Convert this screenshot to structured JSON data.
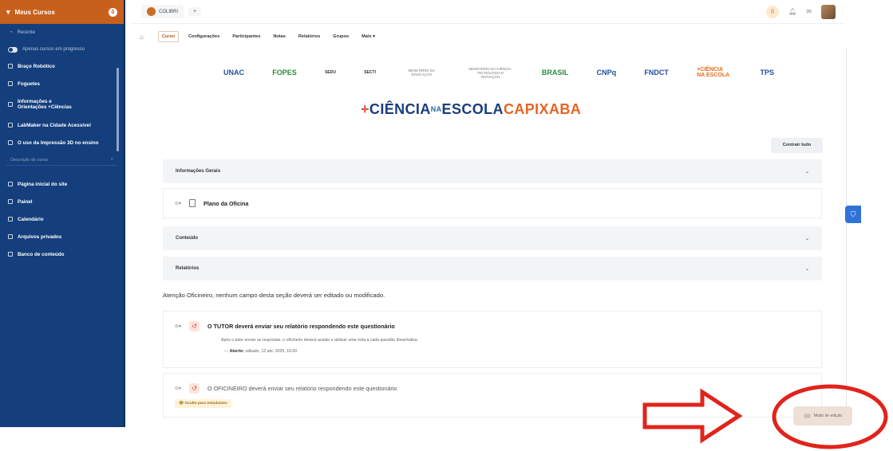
{
  "sidebar": {
    "header": "Meus Cursos",
    "header_badge": "0",
    "sub_item": "Recente",
    "toggle_label": "Apenas cursos em progresso",
    "courses": [
      "Braço Robótico",
      "Foguetes",
      "Informações e Orientações +Ciências",
      "LabMaker na Cidade Acessível",
      "O uso da Impressão 3D no ensino"
    ],
    "search_placeholder": "Descrição do curso",
    "nav": [
      "Página inicial do site",
      "Painel",
      "Calendário",
      "Arquivos privados",
      "Banco de conteúdo"
    ]
  },
  "topbar": {
    "brand": "COLIBRI",
    "plus": "+",
    "notif_count": "6"
  },
  "subnav": {
    "home_icon": "⌂",
    "tabs": [
      "Curso",
      "Configurações",
      "Participantes",
      "Notas",
      "Relatórios",
      "Grupos",
      "Mais ▾"
    ]
  },
  "banner": {
    "logos": [
      "UNAC",
      "FOPES",
      "SEDU",
      "SECTI",
      "MINISTÉRIO DA EDUCAÇÃO",
      "MINISTÉRIO DA CIÊNCIA, TECNOLOGIA E INOVAÇÃO",
      "BRASIL",
      "CNPq",
      "FNDCT",
      "+CIÊNCIA NA ESCOLA",
      "TPS"
    ],
    "title_plus": "+",
    "title_a": "CIÊNCIA",
    "title_b": "NA",
    "title_c": "ESCOLA",
    "title_d": "CAPIXABA"
  },
  "content": {
    "collapse_all": "Contrair tudo",
    "sections": [
      "Informações Gerais",
      "Conteúdo",
      "Relatórios"
    ],
    "activity_plan": "Plano da Oficina",
    "notice": "Atenção Oficineiro, nenhum campo desta seção deverá ser editado ou modificado.",
    "quiz1_title": "O TUTOR deverá enviar seu relatório respondendo este questionário",
    "quiz1_desc": "Após o tutor enviar as respostas, o oficineiro deverá avaliar e atribuir uma nota a cada questão dissertativa.",
    "quiz1_date_label": "Aberto:",
    "quiz1_date": "sábado, 12 abr. 2025, 16:00",
    "quiz2_title": "O OFICINEIRO deverá enviar seu relatório respondendo este questionário",
    "hidden_badge": "Oculto para estudantes",
    "edit_mode": "Modo de edição"
  },
  "colors": {
    "sidebar_bg": "#143e7c",
    "accent_orange": "#c8601d",
    "annotation_red": "#e0241b"
  }
}
